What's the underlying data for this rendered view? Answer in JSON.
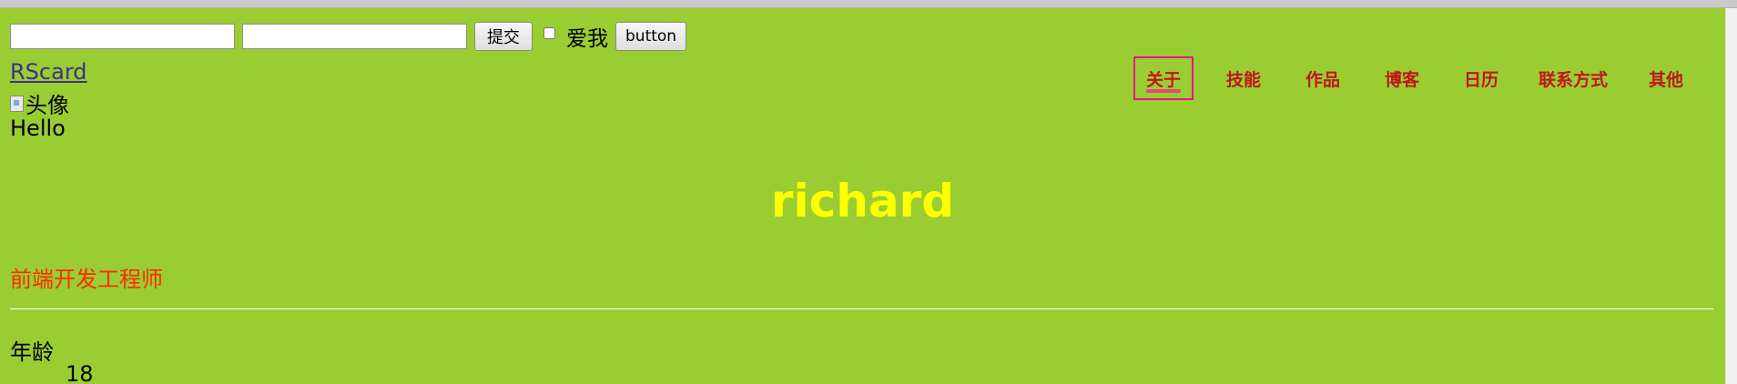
{
  "form": {
    "input1_value": "",
    "input2_value": "",
    "submit_label": "提交",
    "checkbox_label": "爱我",
    "button_label": "button"
  },
  "brand": {
    "text": "RScard"
  },
  "avatar": {
    "alt": "头像"
  },
  "profile": {
    "greeting": "Hello",
    "name": "richard",
    "title": "前端开发工程师",
    "age_label": "年龄",
    "age_value": "18"
  },
  "nav": {
    "items": [
      {
        "label": "关于",
        "active": true
      },
      {
        "label": "技能"
      },
      {
        "label": "作品"
      },
      {
        "label": "博客"
      },
      {
        "label": "日历"
      },
      {
        "label": "联系方式"
      },
      {
        "label": "其他"
      }
    ]
  },
  "colors": {
    "page_bg": "#9acd32",
    "name": "#ffff00",
    "title": "#ff2a00",
    "nav_text": "#c0151b",
    "nav_active_border": "#e6158b"
  }
}
